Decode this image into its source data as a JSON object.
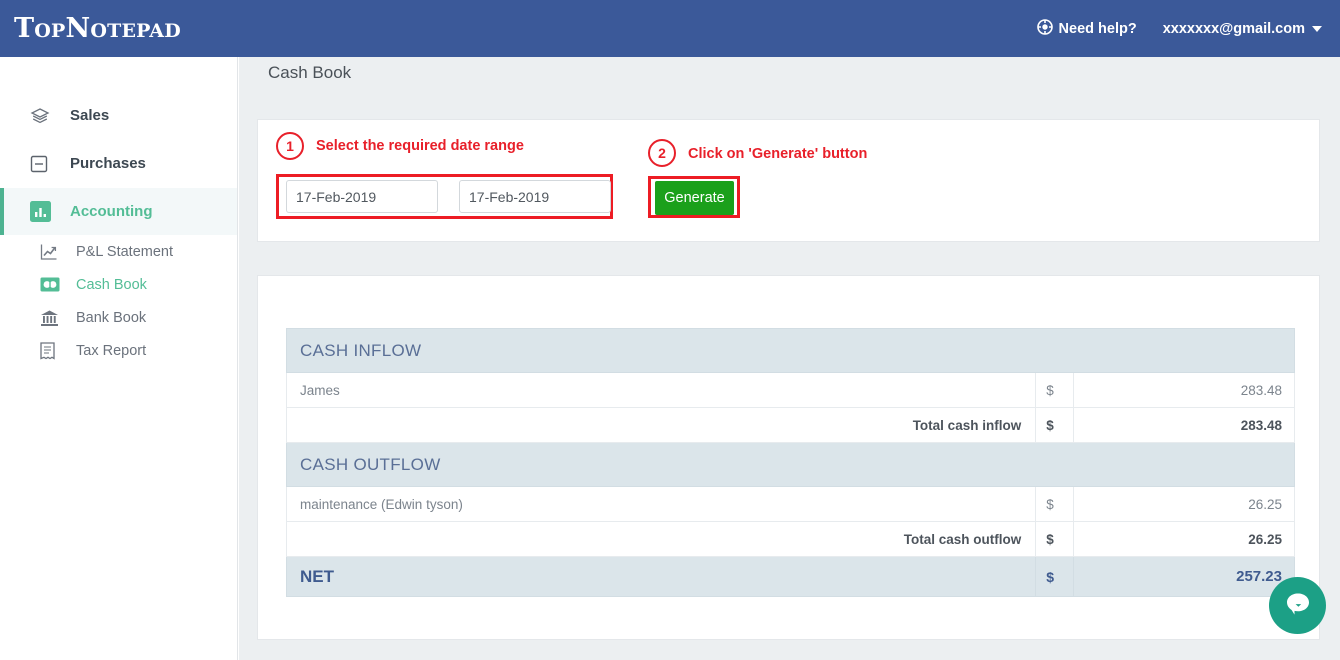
{
  "header": {
    "logo": "TopNotepad",
    "help_label": "Need help?",
    "help_icon": "lifebuoy-icon",
    "account_email": "xxxxxxx@gmail.com",
    "caret_icon": "caret-down-icon",
    "background": "#3b5999"
  },
  "sidebar": {
    "items": [
      {
        "label": "Sales",
        "icon": "layers-icon",
        "active": false
      },
      {
        "label": "Purchases",
        "icon": "minus-square-icon",
        "active": false
      },
      {
        "label": "Accounting",
        "icon": "bar-chart-icon",
        "active": true
      }
    ],
    "sub_items": [
      {
        "label": "P&L Statement",
        "icon": "line-chart-icon",
        "active": false
      },
      {
        "label": "Cash Book",
        "icon": "banknote-icon",
        "active": true
      },
      {
        "label": "Bank Book",
        "icon": "bank-icon",
        "active": false
      },
      {
        "label": "Tax Report",
        "icon": "receipt-icon",
        "active": false
      }
    ],
    "accent_color": "#53bd96"
  },
  "main": {
    "page_title": "Cash Book"
  },
  "filter": {
    "annotations": [
      {
        "number": "1",
        "text": "Select the required date range"
      },
      {
        "number": "2",
        "text": "Click on 'Generate' button"
      }
    ],
    "date_from": "17-Feb-2019",
    "date_to": "17-Feb-2019",
    "date_placeholder": "17-Feb-2019",
    "generate_label": "Generate",
    "generate_color": "#1ba01b",
    "annotation_color": "#e8202a"
  },
  "report": {
    "currency_symbol": "$",
    "sections": [
      {
        "title": "CASH INFLOW",
        "rows": [
          {
            "description": "James",
            "currency": "$",
            "amount": "283.48"
          }
        ],
        "total_label": "Total cash inflow",
        "total_currency": "$",
        "total_amount": "283.48"
      },
      {
        "title": "CASH OUTFLOW",
        "rows": [
          {
            "description": "maintenance (Edwin tyson)",
            "currency": "$",
            "amount": "26.25"
          }
        ],
        "total_label": "Total cash outflow",
        "total_currency": "$",
        "total_amount": "26.25"
      }
    ],
    "net": {
      "label": "NET",
      "currency": "$",
      "amount": "257.23"
    },
    "header_bg": "#dbe5ea",
    "header_text_color": "#5a6f96"
  },
  "chat": {
    "icon": "chat-bubble-icon",
    "color": "#1ca086"
  }
}
